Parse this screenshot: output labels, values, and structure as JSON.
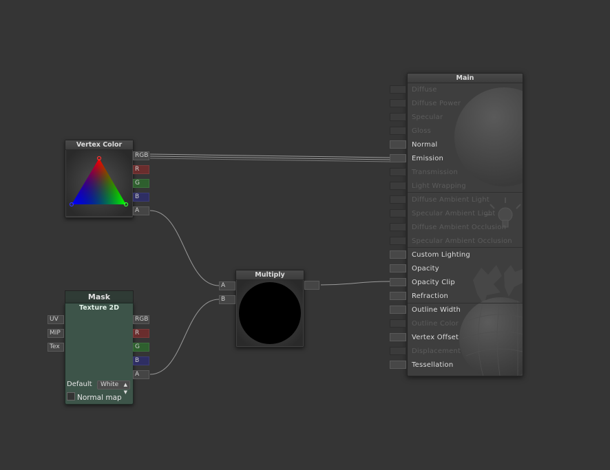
{
  "vertex_color": {
    "title": "Vertex Color",
    "outputs": [
      "RGB",
      "R",
      "G",
      "B",
      "A"
    ]
  },
  "mask": {
    "header": "Mask",
    "title": "Texture 2D",
    "inputs": [
      "UV",
      "MIP",
      "Tex"
    ],
    "outputs": [
      "RGB",
      "R",
      "G",
      "B",
      "A"
    ],
    "default_label": "Default",
    "default_value": "White",
    "normal_map_label": "Normal map"
  },
  "multiply": {
    "title": "Multiply",
    "inputs": [
      "A",
      "B"
    ]
  },
  "main": {
    "title": "Main",
    "inputs": [
      {
        "label": "Diffuse",
        "active": false
      },
      {
        "label": "Diffuse Power",
        "active": false
      },
      {
        "label": "Specular",
        "active": false
      },
      {
        "label": "Gloss",
        "active": false
      },
      {
        "label": "Normal",
        "active": true
      },
      {
        "label": "Emission",
        "active": true
      },
      {
        "label": "Transmission",
        "active": false
      },
      {
        "label": "Light Wrapping",
        "active": false
      },
      {
        "label": "Diffuse Ambient Light",
        "active": false
      },
      {
        "label": "Specular Ambient Light",
        "active": false
      },
      {
        "label": "Diffuse Ambient Occlusion",
        "active": false
      },
      {
        "label": "Specular Ambient Occlusion",
        "active": false
      },
      {
        "label": "Custom Lighting",
        "active": true
      },
      {
        "label": "Opacity",
        "active": true
      },
      {
        "label": "Opacity Clip",
        "active": true
      },
      {
        "label": "Refraction",
        "active": true
      },
      {
        "label": "Outline Width",
        "active": true
      },
      {
        "label": "Outline Color",
        "active": false
      },
      {
        "label": "Vertex Offset",
        "active": true
      },
      {
        "label": "Displacement",
        "active": false
      },
      {
        "label": "Tessellation",
        "active": true
      }
    ]
  },
  "colors": {
    "canvas": "#353535",
    "node": "#3f3f3f",
    "texture_node": "#3d5449",
    "port_red": "#6a2d2d",
    "port_green": "#2e5f2e",
    "port_blue": "#2e2e63",
    "wire": "#9a9a9a"
  }
}
